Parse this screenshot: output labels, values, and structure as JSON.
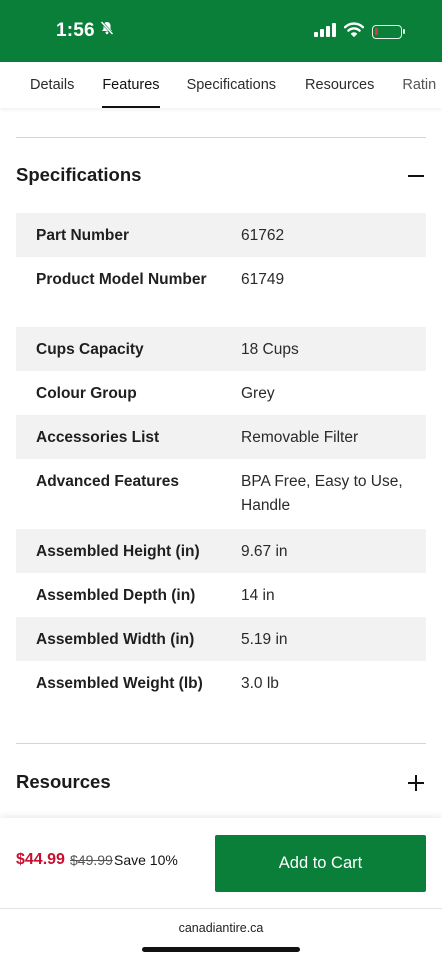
{
  "status_bar": {
    "time": "1:56",
    "background_color": "#0a7f3a",
    "icons": [
      "bell-slash-icon",
      "cellular-signal-icon",
      "wifi-icon",
      "battery-low-icon"
    ],
    "battery_level": 0.15
  },
  "tabs": [
    {
      "label": "Details",
      "active": false
    },
    {
      "label": "Features",
      "active": true
    },
    {
      "label": "Specifications",
      "active": false
    },
    {
      "label": "Resources",
      "active": false
    },
    {
      "label": "Ratin",
      "active": false
    }
  ],
  "specifications": {
    "title": "Specifications",
    "toggle_icon": "minus-icon",
    "rows": [
      {
        "label": "Part Number",
        "value": "61762"
      },
      {
        "label": "Product Model Number",
        "value": "61749"
      },
      {
        "label": "Cups Capacity",
        "value": "18 Cups"
      },
      {
        "label": "Colour Group",
        "value": "Grey"
      },
      {
        "label": "Accessories List",
        "value": "Removable Filter"
      },
      {
        "label": "Advanced Features",
        "value": "BPA Free, Easy to Use, Handle"
      },
      {
        "label": "Assembled Height (in)",
        "value": "9.67 in"
      },
      {
        "label": "Assembled Depth (in)",
        "value": "14 in"
      },
      {
        "label": "Assembled Width (in)",
        "value": "5.19 in"
      },
      {
        "label": "Assembled Weight (lb)",
        "value": "3.0 lb"
      }
    ]
  },
  "resources": {
    "title": "Resources",
    "toggle_icon": "plus-icon"
  },
  "purchase": {
    "sale_price": "$44.99",
    "regular_price": "$49.99",
    "savings": "Save 10%",
    "add_to_cart_label": "Add to Cart",
    "sale_color": "#c8102e",
    "button_color": "#0a7f3a"
  },
  "browser": {
    "url": "canadiantire.ca"
  }
}
